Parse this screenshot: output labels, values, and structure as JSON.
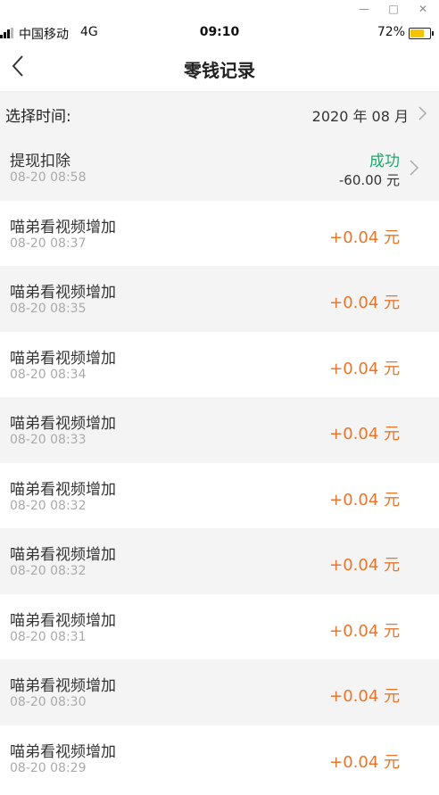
{
  "window": {
    "minimize_icon": "minimize-icon",
    "maximize_icon": "maximize-icon",
    "close_icon": "close-icon"
  },
  "status_bar": {
    "carrier": "中国移动",
    "network": "4G",
    "time": "09:10",
    "battery": "72%",
    "battery_level": 0.72,
    "battery_color": "#f6c400"
  },
  "nav": {
    "title": "零钱记录",
    "back_icon": "back-arrow-icon"
  },
  "filter": {
    "label": "选择时间:",
    "value": "2020 年 08 月"
  },
  "colors": {
    "positive": "#e8752a",
    "success": "#22a66e",
    "alt_row": "#f4f4f4"
  },
  "records": [
    {
      "title": "提现扣除",
      "time": "08-20 08:58",
      "status": "成功",
      "amount": "-60.00 元"
    },
    {
      "title": "喵弟看视频增加",
      "time": "08-20 08:37",
      "amount": "+0.04 元"
    },
    {
      "title": "喵弟看视频增加",
      "time": "08-20 08:35",
      "amount": "+0.04 元"
    },
    {
      "title": "喵弟看视频增加",
      "time": "08-20 08:34",
      "amount": "+0.04 元"
    },
    {
      "title": "喵弟看视频增加",
      "time": "08-20 08:33",
      "amount": "+0.04 元"
    },
    {
      "title": "喵弟看视频增加",
      "time": "08-20 08:32",
      "amount": "+0.04 元"
    },
    {
      "title": "喵弟看视频增加",
      "time": "08-20 08:32",
      "amount": "+0.04 元"
    },
    {
      "title": "喵弟看视频增加",
      "time": "08-20 08:31",
      "amount": "+0.04 元"
    },
    {
      "title": "喵弟看视频增加",
      "time": "08-20 08:30",
      "amount": "+0.04 元"
    },
    {
      "title": "喵弟看视频增加",
      "time": "08-20 08:29",
      "amount": "+0.04 元"
    }
  ]
}
